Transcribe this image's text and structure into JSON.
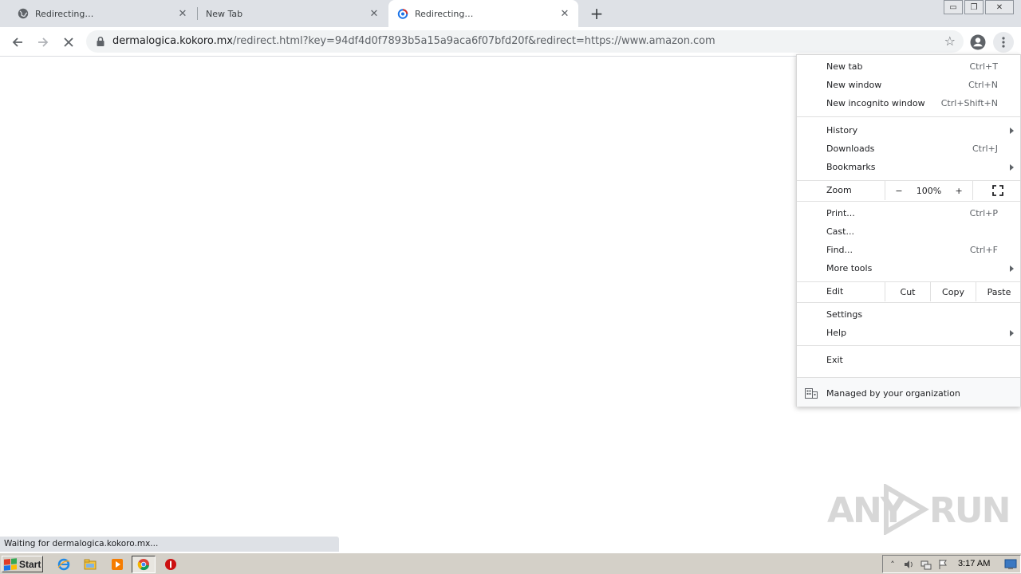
{
  "tabs": [
    {
      "title": "Redirecting…",
      "favicon": "globe-icon",
      "active": false
    },
    {
      "title": "New Tab",
      "favicon": "",
      "active": false
    },
    {
      "title": "Redirecting…",
      "favicon": "chrome-loading-icon",
      "active": true
    }
  ],
  "omnibox": {
    "host": "dermalogica.kokoro.mx",
    "path": "/redirect.html?key=94df4d0f7893b5a15a9aca6f07bfd20f&redirect=https://www.amazon.com"
  },
  "menu": {
    "group1": [
      {
        "label": "New tab",
        "shortcut": "Ctrl+T"
      },
      {
        "label": "New window",
        "shortcut": "Ctrl+N"
      },
      {
        "label": "New incognito window",
        "shortcut": "Ctrl+Shift+N"
      }
    ],
    "group2": [
      {
        "label": "History",
        "shortcut": "",
        "submenu": true
      },
      {
        "label": "Downloads",
        "shortcut": "Ctrl+J",
        "submenu": false
      },
      {
        "label": "Bookmarks",
        "shortcut": "",
        "submenu": true
      }
    ],
    "zoom": {
      "label": "Zoom",
      "minus": "−",
      "value": "100%",
      "plus": "+"
    },
    "group3": [
      {
        "label": "Print...",
        "shortcut": "Ctrl+P",
        "submenu": false
      },
      {
        "label": "Cast...",
        "shortcut": "",
        "submenu": false
      },
      {
        "label": "Find...",
        "shortcut": "Ctrl+F",
        "submenu": false
      },
      {
        "label": "More tools",
        "shortcut": "",
        "submenu": true
      }
    ],
    "edit": {
      "label": "Edit",
      "cut": "Cut",
      "copy": "Copy",
      "paste": "Paste"
    },
    "group4": [
      {
        "label": "Settings",
        "submenu": false
      },
      {
        "label": "Help",
        "submenu": true
      }
    ],
    "exit": "Exit",
    "managed": "Managed by your organization"
  },
  "status_text": "Waiting for dermalogica.kokoro.mx...",
  "watermark": {
    "left": "ANY",
    "right": "RUN"
  },
  "taskbar": {
    "start_label": "Start",
    "clock": "3:17 AM"
  },
  "colors": {
    "tabstrip": "#dee1e6",
    "omnibox": "#f1f3f4",
    "taskbar": "#d4d0c8"
  }
}
